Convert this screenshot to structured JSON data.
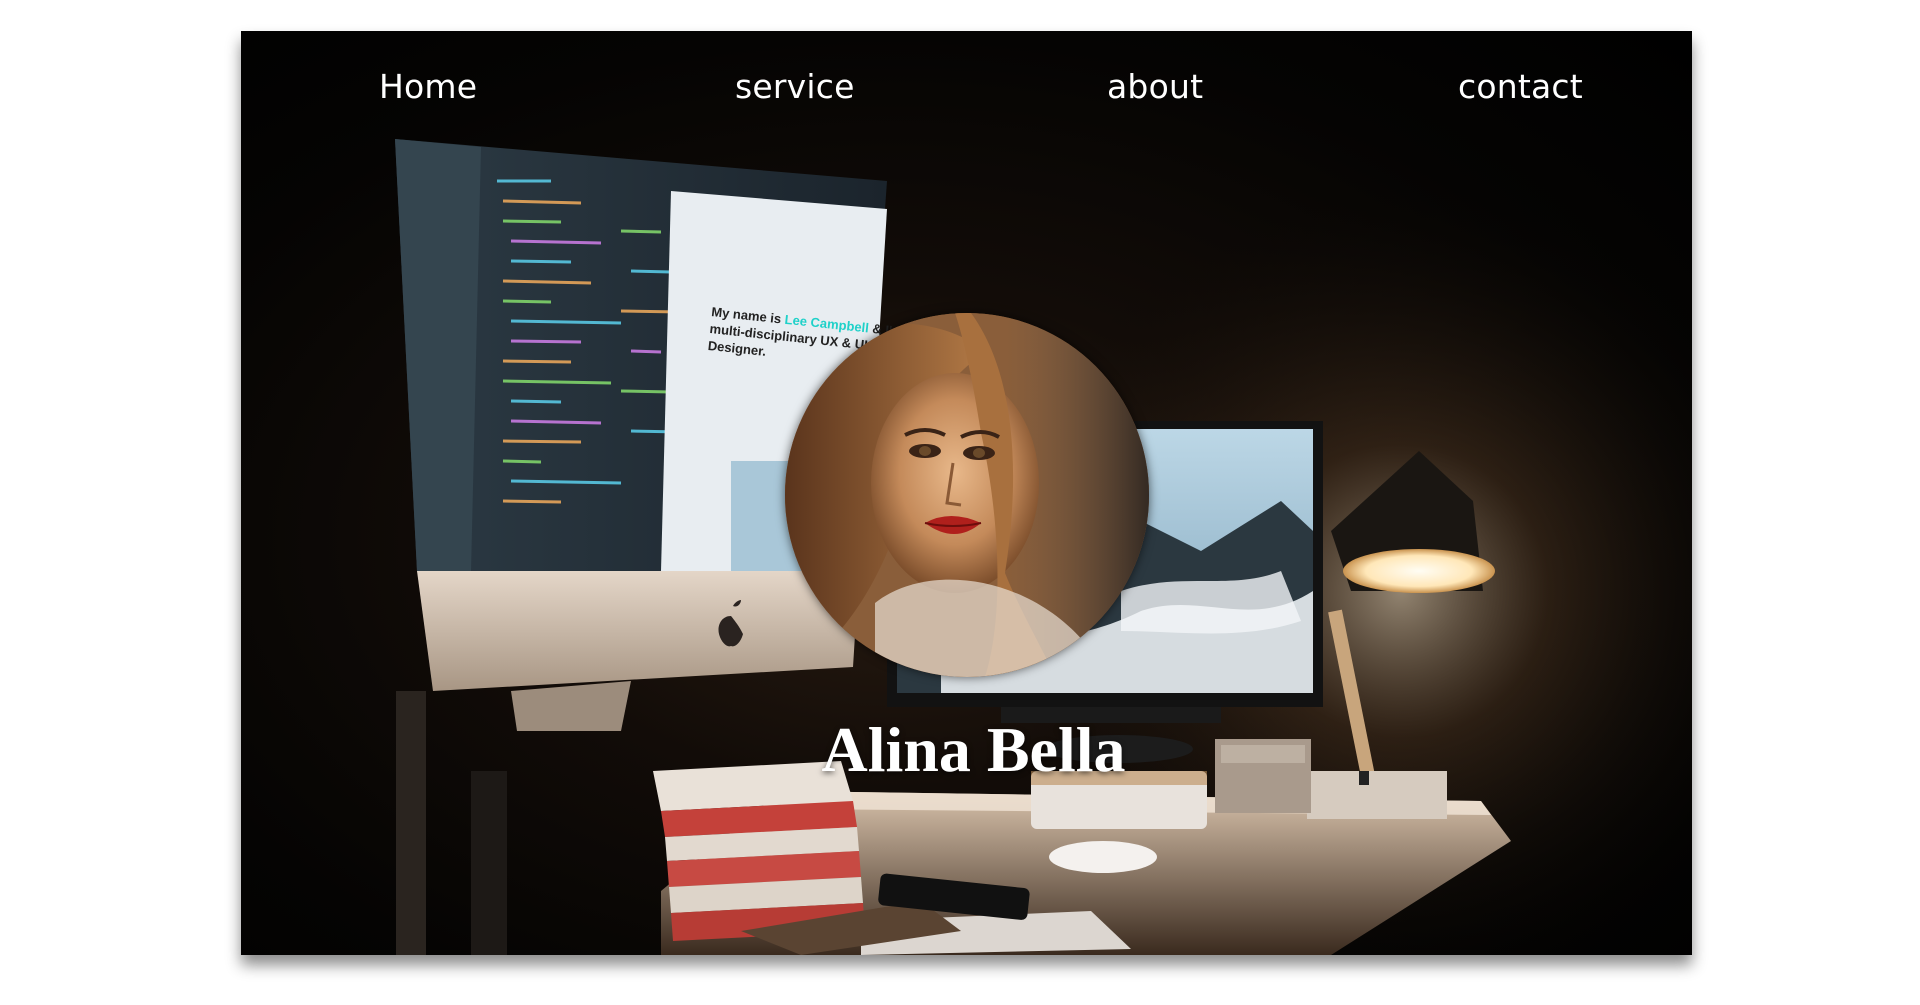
{
  "nav": {
    "items": [
      {
        "label": "Home"
      },
      {
        "label": "service"
      },
      {
        "label": "about"
      },
      {
        "label": "contact"
      }
    ]
  },
  "hero": {
    "name": "Alina Bella",
    "screen_text": "My name is Lee Campbell & I'm a multi-disciplinary UX & UI Designer."
  },
  "colors": {
    "background": "#ffffff",
    "hero_bg": "#000000",
    "nav_text": "#ffffff",
    "name_text": "#ffffff",
    "screen_accent": "#1fd1c9"
  }
}
